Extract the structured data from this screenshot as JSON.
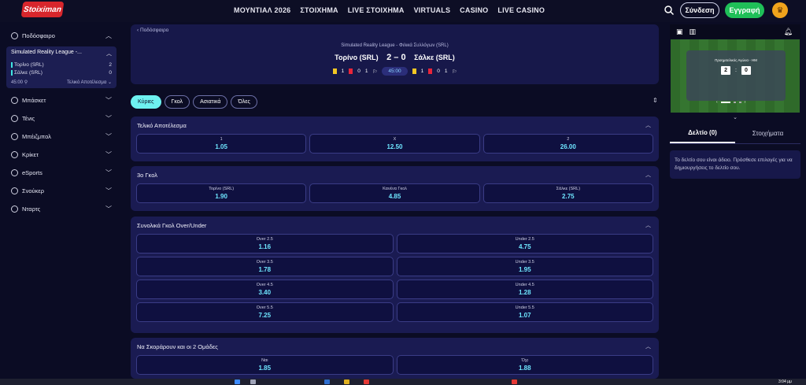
{
  "header": {
    "logo_text": "Stoiximan",
    "nav": [
      "ΜΟΥΝΤΙΑΛ 2026",
      "ΣΤΟΙΧΗΜΑ",
      "LIVE ΣΤΟΙΧΗΜΑ",
      "VIRTUALS",
      "CASINO",
      "LIVE CASINO"
    ],
    "login_label": "Σύνδεση",
    "register_label": "Εγγραφή"
  },
  "sidebar": {
    "football": "Ποδόσφαιρο",
    "league": {
      "title": "Simulated Reality League -...",
      "home": "Τορίνο (SRL)",
      "home_score": "2",
      "away": "Σάλκε (SRL)",
      "away_score": "0",
      "time": "45:00",
      "market": "Τελικό Αποτέλεσμα"
    },
    "sports": [
      "Μπάσκετ",
      "Τένις",
      "Μπέιζμπολ",
      "Κρίκετ",
      "eSports",
      "Σνούκερ",
      "Νταρτς"
    ]
  },
  "match": {
    "back_label": "Ποδόσφαιρο",
    "league": "Simulated Reality League - Φιλικά Συλλόγων (SRL)",
    "home": "Τορίνο (SRL)",
    "score": "2 – 0",
    "away": "Σάλκε (SRL)",
    "home_yc": "1",
    "home_rc": "0",
    "home_corners": "1",
    "time": "45:00",
    "away_yc": "1",
    "away_rc": "0",
    "away_corners": "1"
  },
  "tabs": [
    "Κύριες",
    "Γκολ",
    "Ασιατικά",
    "Όλες"
  ],
  "markets": [
    {
      "title": "Τελικό Αποτέλεσμα",
      "rows": [
        [
          {
            "l": "1",
            "v": "1.05"
          },
          {
            "l": "X",
            "v": "12.50"
          },
          {
            "l": "2",
            "v": "26.00"
          }
        ]
      ]
    },
    {
      "title": "3ο Γκολ",
      "rows": [
        [
          {
            "l": "Τορίνο (SRL)",
            "v": "1.90"
          },
          {
            "l": "Κανένα Γκολ",
            "v": "4.85"
          },
          {
            "l": "Σάλκε (SRL)",
            "v": "2.75"
          }
        ]
      ]
    },
    {
      "title": "Συνολικά Γκολ Over/Under",
      "rows": [
        [
          {
            "l": "Over 2.5",
            "v": "1.16"
          },
          {
            "l": "Under 2.5",
            "v": "4.75"
          }
        ],
        [
          {
            "l": "Over 3.5",
            "v": "1.78"
          },
          {
            "l": "Under 3.5",
            "v": "1.95"
          }
        ],
        [
          {
            "l": "Over 4.5",
            "v": "3.40"
          },
          {
            "l": "Under 4.5",
            "v": "1.28"
          }
        ],
        [
          {
            "l": "Over 5.5",
            "v": "7.25"
          },
          {
            "l": "Under 5.5",
            "v": "1.07"
          }
        ]
      ]
    },
    {
      "title": "Να Σκοράρουν και οι 2 Ομάδες",
      "rows": [
        [
          {
            "l": "Ναι",
            "v": "1.85"
          },
          {
            "l": "Όχι",
            "v": "1.88"
          }
        ]
      ]
    }
  ],
  "video": {
    "box_title": "Προημιτελικός Αγώνα - ΗΜ",
    "home_score": "2",
    "away_score": "0"
  },
  "betslip": {
    "tab_slip": "Δελτίο (0)",
    "tab_bets": "Στοιχήματα",
    "empty_text": "Το δελτίο σου είναι άδειο. Πρόσθεσε επιλογές για να δημιουργήσεις το δελτίο σου."
  },
  "taskbar": {
    "clock": "3:04 μμ"
  },
  "colors": {
    "accent": "#6ef1f0",
    "odds": "#6ee6ff",
    "register": "#1fbf58",
    "logo": "#d8262c"
  }
}
